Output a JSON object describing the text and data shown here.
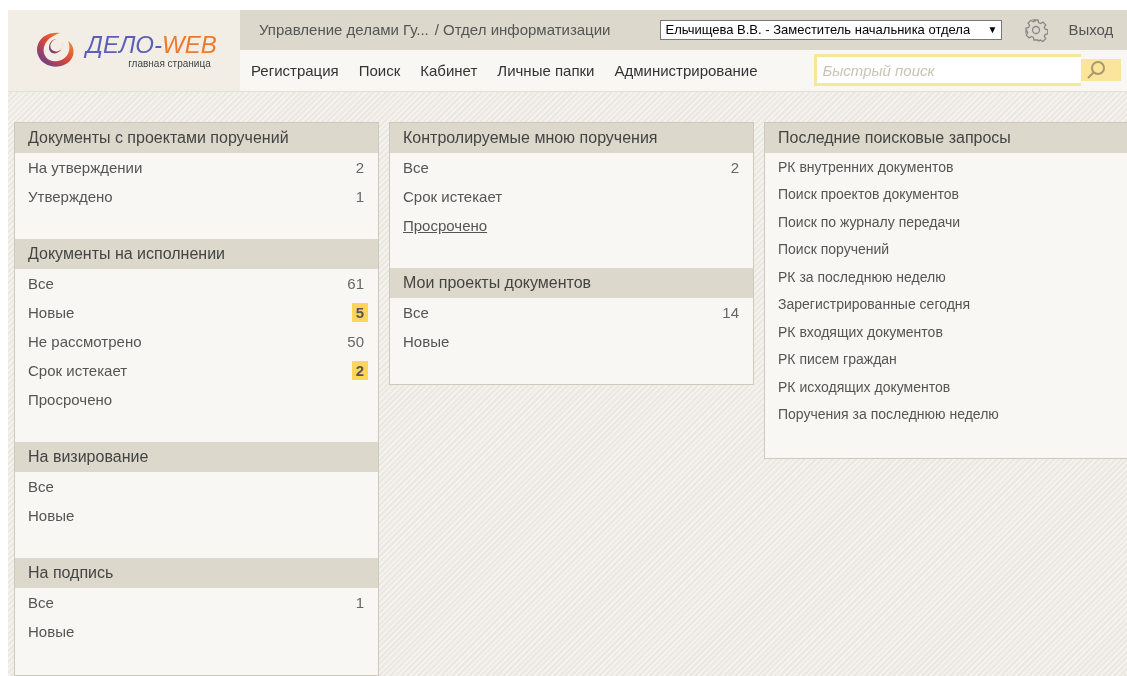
{
  "logo": {
    "title_main": "ДЕЛО-",
    "title_accent": "WEB",
    "subtitle": "главная страница"
  },
  "breadcrumb": {
    "organization": "Управление делами Гу...",
    "department": "/ Отдел информатизации"
  },
  "user_select": {
    "value": "Ельчищева В.В. - Заместитель начальника отдела",
    "arrow": "▼"
  },
  "logout": "Выход",
  "nav": [
    {
      "label": "Регистрация"
    },
    {
      "label": "Поиск"
    },
    {
      "label": "Кабинет"
    },
    {
      "label": "Личные папки"
    },
    {
      "label": "Администрирование"
    }
  ],
  "quick_search": {
    "placeholder": "Быстрый поиск"
  },
  "columns": [
    {
      "sections": [
        {
          "title": "Документы с проектами поручений",
          "items": [
            {
              "label": "На утверждении",
              "count": "2",
              "highlighted": false
            },
            {
              "label": "Утверждено",
              "count": "1",
              "highlighted": false
            }
          ]
        },
        {
          "title": "Документы на исполнении",
          "items": [
            {
              "label": "Все",
              "count": "61",
              "highlighted": false
            },
            {
              "label": "Новые",
              "count": "5",
              "highlighted": true
            },
            {
              "label": "Не рассмотрено",
              "count": "50",
              "highlighted": false
            },
            {
              "label": "Срок истекает",
              "count": "2",
              "highlighted": true
            },
            {
              "label": "Просрочено"
            }
          ]
        },
        {
          "title": "На визирование",
          "items": [
            {
              "label": "Все"
            },
            {
              "label": "Новые"
            }
          ]
        },
        {
          "title": "На подпись",
          "items": [
            {
              "label": "Все",
              "count": "1",
              "highlighted": false
            },
            {
              "label": "Новые"
            }
          ]
        }
      ]
    },
    {
      "sections": [
        {
          "title": "Контролируемые мною поручения",
          "items": [
            {
              "label": "Все",
              "count": "2",
              "highlighted": false,
              "underlined": false
            },
            {
              "label": "Срок истекает",
              "underlined": false
            },
            {
              "label": "Просрочено",
              "underlined": true
            }
          ]
        },
        {
          "title": "Мои проекты документов",
          "items": [
            {
              "label": "Все",
              "count": "14",
              "highlighted": false
            },
            {
              "label": "Новые"
            }
          ]
        }
      ]
    },
    {
      "sections": [
        {
          "title": "Последние поисковые запросы",
          "items": [
            {
              "label": "РК внутренних документов"
            },
            {
              "label": "Поиск проектов документов"
            },
            {
              "label": "Поиск по журналу передачи"
            },
            {
              "label": "Поиск поручений"
            },
            {
              "label": "РК за последнюю неделю"
            },
            {
              "label": "Зарегистрированные сегодня"
            },
            {
              "label": "РК входящих документов"
            },
            {
              "label": "РК писем граждан"
            },
            {
              "label": "РК исходящих документов"
            },
            {
              "label": "Поручения за последнюю неделю"
            }
          ]
        }
      ]
    }
  ]
}
